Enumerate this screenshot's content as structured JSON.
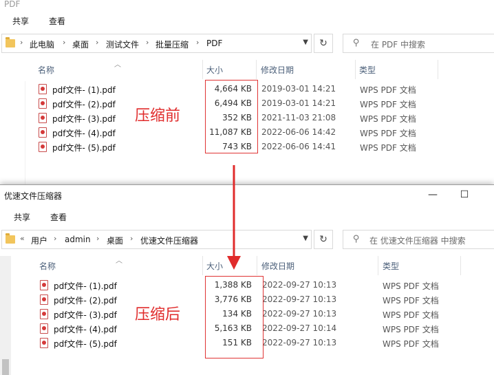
{
  "window_before": {
    "title": "PDF",
    "ribbon": {
      "share": "共享",
      "view": "查看"
    },
    "breadcrumb": [
      "此电脑",
      "桌面",
      "测试文件",
      "批量压缩",
      "PDF"
    ],
    "search_placeholder": "在 PDF 中搜索",
    "columns": {
      "name": "名称",
      "size": "大小",
      "date": "修改日期",
      "type": "类型"
    },
    "files": [
      {
        "name": "pdf文件- (1).pdf",
        "size": "4,664 KB",
        "date": "2019-03-01 14:21",
        "type": "WPS PDF 文档"
      },
      {
        "name": "pdf文件- (2).pdf",
        "size": "6,494 KB",
        "date": "2019-03-01 14:21",
        "type": "WPS PDF 文档"
      },
      {
        "name": "pdf文件- (3).pdf",
        "size": "352 KB",
        "date": "2021-11-03 21:08",
        "type": "WPS PDF 文档"
      },
      {
        "name": "pdf文件- (4).pdf",
        "size": "11,087 KB",
        "date": "2022-06-06 14:42",
        "type": "WPS PDF 文档"
      },
      {
        "name": "pdf文件- (5).pdf",
        "size": "743 KB",
        "date": "2022-06-06 14:41",
        "type": "WPS PDF 文档"
      }
    ],
    "annotation": "压缩前"
  },
  "window_after": {
    "title": "优速文件压缩器",
    "ribbon": {
      "share": "共享",
      "view": "查看"
    },
    "breadcrumb_prefix": "«",
    "breadcrumb": [
      "用户",
      "admin",
      "桌面",
      "优速文件压缩器"
    ],
    "search_placeholder": "在 优速文件压缩器 中搜索",
    "columns": {
      "name": "名称",
      "size": "大小",
      "date": "修改日期",
      "type": "类型"
    },
    "files": [
      {
        "name": "pdf文件- (1).pdf",
        "size": "1,388 KB",
        "date": "2022-09-27 10:13",
        "type": "WPS PDF 文档"
      },
      {
        "name": "pdf文件- (2).pdf",
        "size": "3,776 KB",
        "date": "2022-09-27 10:13",
        "type": "WPS PDF 文档"
      },
      {
        "name": "pdf文件- (3).pdf",
        "size": "134 KB",
        "date": "2022-09-27 10:13",
        "type": "WPS PDF 文档"
      },
      {
        "name": "pdf文件- (4).pdf",
        "size": "5,163 KB",
        "date": "2022-09-27 10:14",
        "type": "WPS PDF 文档"
      },
      {
        "name": "pdf文件- (5).pdf",
        "size": "151 KB",
        "date": "2022-09-27 10:13",
        "type": "WPS PDF 文档"
      }
    ],
    "annotation": "压缩后",
    "window_controls": {
      "minimize": "—",
      "maximize": "☐"
    }
  },
  "colors": {
    "annotation_red": "#e02b2b",
    "folder_yellow": "#f2c55c",
    "header_text": "#4c607a"
  },
  "icons": [
    "folder-icon",
    "pdf-file-icon",
    "refresh-icon",
    "search-icon",
    "chevron-down-icon",
    "sort-up-icon",
    "minimize-icon",
    "maximize-icon",
    "down-arrow-annotation"
  ]
}
